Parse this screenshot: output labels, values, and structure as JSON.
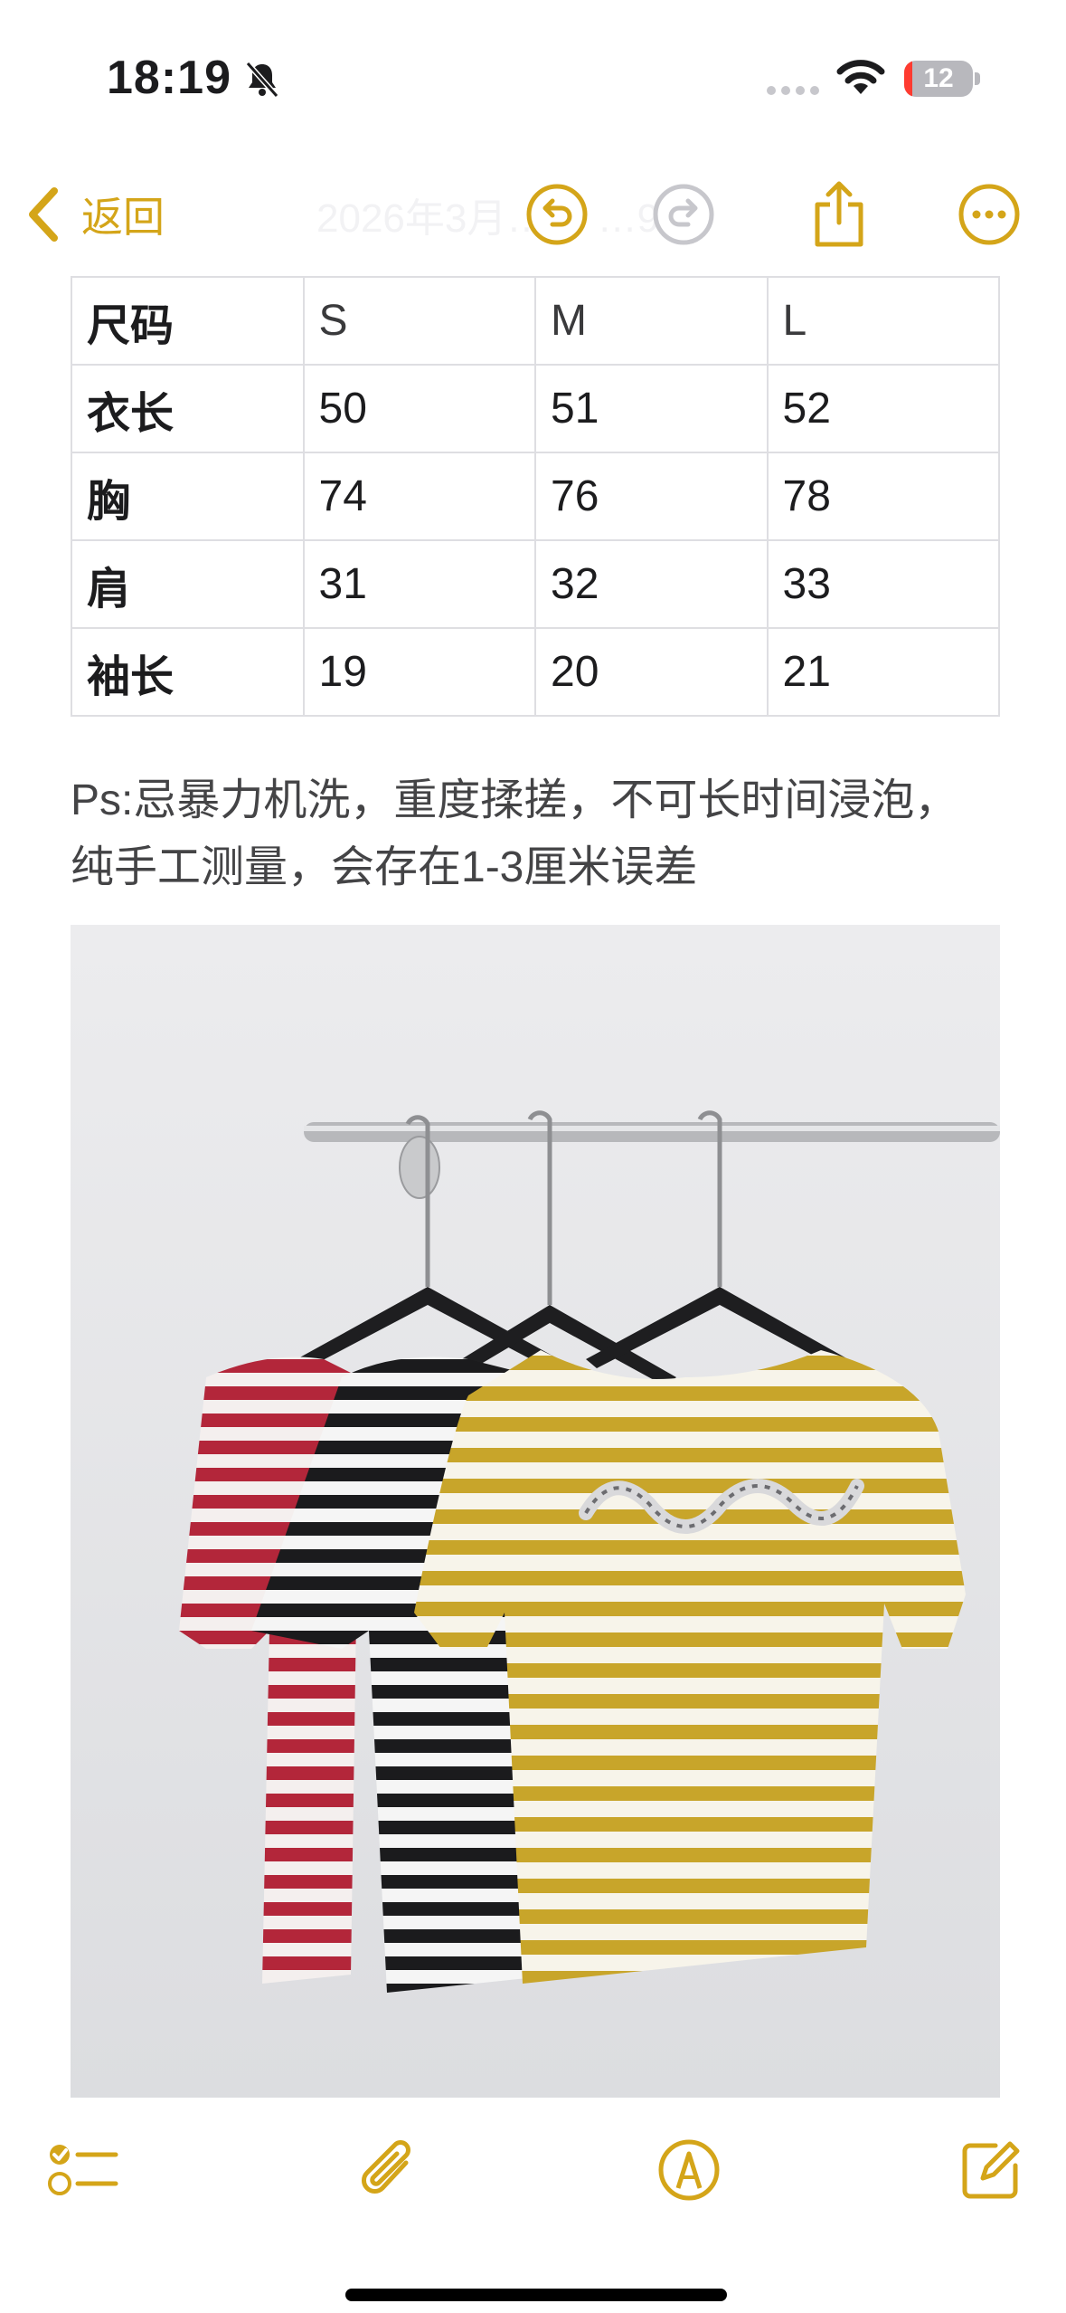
{
  "status_bar": {
    "time": "18:19",
    "battery": "12",
    "battery_level": 0.12
  },
  "nav": {
    "back_label": "返回",
    "title": "2026年3月…日 …9"
  },
  "size_table": {
    "rows": [
      [
        "尺码",
        "S",
        "M",
        "L"
      ],
      [
        "衣长",
        "50",
        "51",
        "52"
      ],
      [
        "胸",
        "74",
        "76",
        "78"
      ],
      [
        "肩",
        "31",
        "32",
        "33"
      ],
      [
        "袖长",
        "19",
        "20",
        "21"
      ]
    ]
  },
  "note": {
    "line1": "Ps:忌暴力机洗，重度揉搓，不可长时间浸泡，",
    "line2": "纯手工测量，会存在1-3厘米误差"
  },
  "photo": {
    "description_icon": "product-photo-striped-tees"
  },
  "colors": {
    "accent": "#d4a519",
    "text": "#1c1c1e",
    "border": "#dedee2"
  }
}
